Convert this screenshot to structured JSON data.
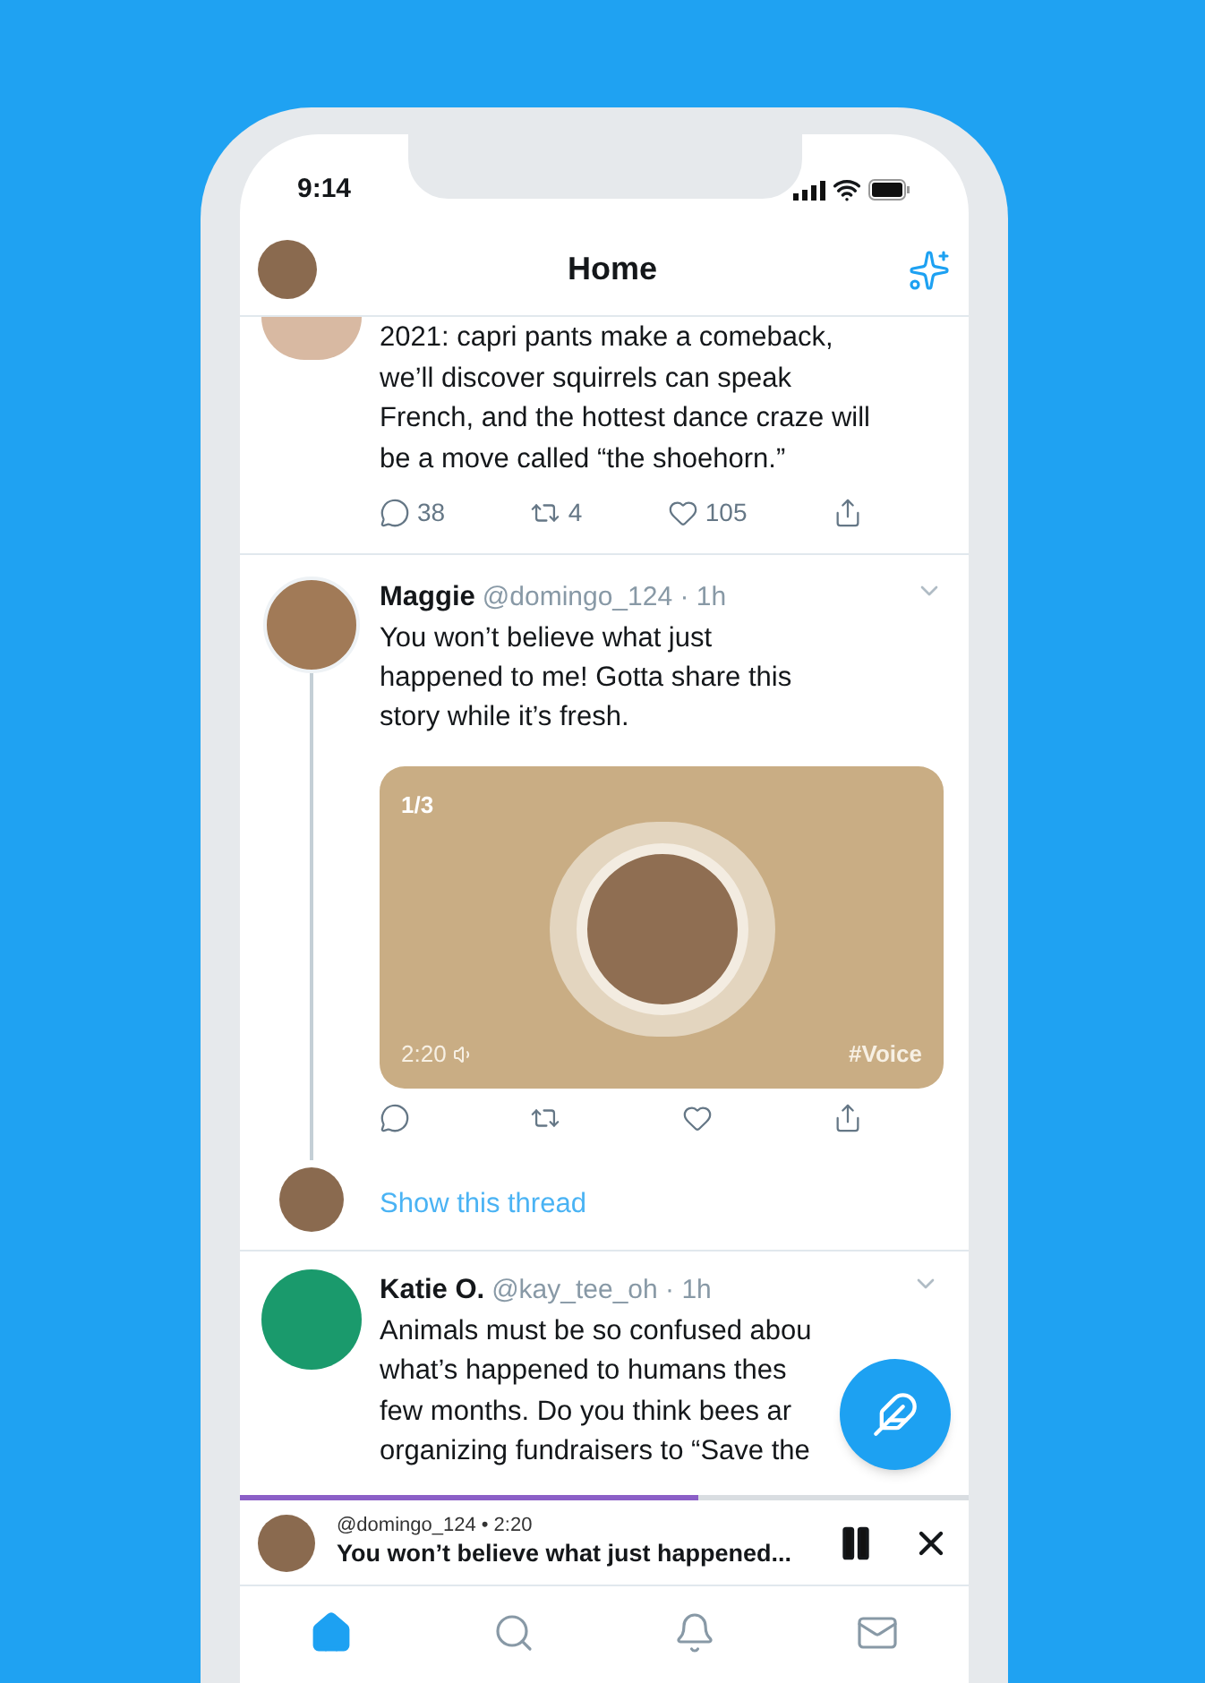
{
  "status_bar": {
    "time": "9:14"
  },
  "header": {
    "title": "Home"
  },
  "partial_tweet": {
    "text_lines": [
      "2021: capri pants make a comeback,",
      "we’ll discover squirrels can speak",
      "French, and the hottest dance craze will",
      "be a move called “the shoehorn.”"
    ],
    "actions": [
      {
        "kind": "reply",
        "count": "38"
      },
      {
        "kind": "retweet",
        "count": "4"
      },
      {
        "kind": "like",
        "count": "105"
      },
      {
        "kind": "share"
      }
    ]
  },
  "thread_tweet": {
    "name": "Maggie",
    "meta": "@domingo_124 · 1h",
    "text_lines": [
      "You won’t believe what just",
      "happened to me! Gotta share this",
      "story while it’s fresh."
    ],
    "voice_card": {
      "counter": "1/3",
      "duration": "2:20",
      "hashtag": "#Voice"
    },
    "actions": [
      {
        "kind": "reply"
      },
      {
        "kind": "retweet"
      },
      {
        "kind": "like"
      },
      {
        "kind": "share"
      }
    ],
    "show_thread": "Show this thread"
  },
  "tweet": {
    "name": "Katie O.",
    "meta": "@kay_tee_oh · 1h",
    "text_lines": [
      "Animals must be so confused abou",
      "what’s happened to humans thes",
      "few months. Do you think bees ar",
      "organizing fundraisers to “Save the"
    ]
  },
  "player": {
    "level": 0.63,
    "subtitle": "@domingo_124 • 2:20",
    "title": "You won’t believe what just happened...",
    "playing": true
  },
  "nav": [
    {
      "kind": "home",
      "selected": true
    },
    {
      "kind": "search",
      "selected": false
    },
    {
      "kind": "notifications",
      "selected": false
    },
    {
      "kind": "messages",
      "selected": false
    }
  ]
}
